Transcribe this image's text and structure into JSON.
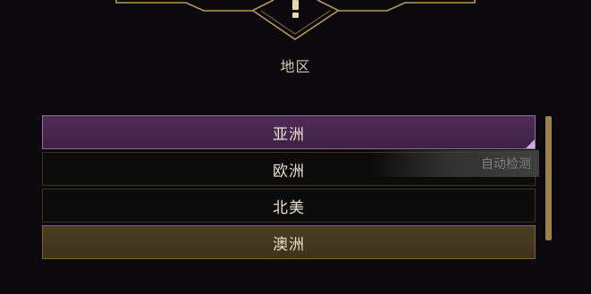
{
  "header": {
    "icon": "exclamation-icon"
  },
  "region_label": "地区",
  "regions": [
    {
      "label": "亚洲",
      "state": "selected"
    },
    {
      "label": "欧洲",
      "state": "normal"
    },
    {
      "label": "北美",
      "state": "normal"
    },
    {
      "label": "澳洲",
      "state": "highlight"
    }
  ],
  "tooltip": {
    "text": "自动检测"
  },
  "scrollbar": {
    "position": 0,
    "thumb_fraction": 0.84
  },
  "colors": {
    "background": "#0b090e",
    "gold_accent": "#b89a5a",
    "selected_purple": "#4f2c57",
    "highlight_gold": "#4a3d22"
  }
}
